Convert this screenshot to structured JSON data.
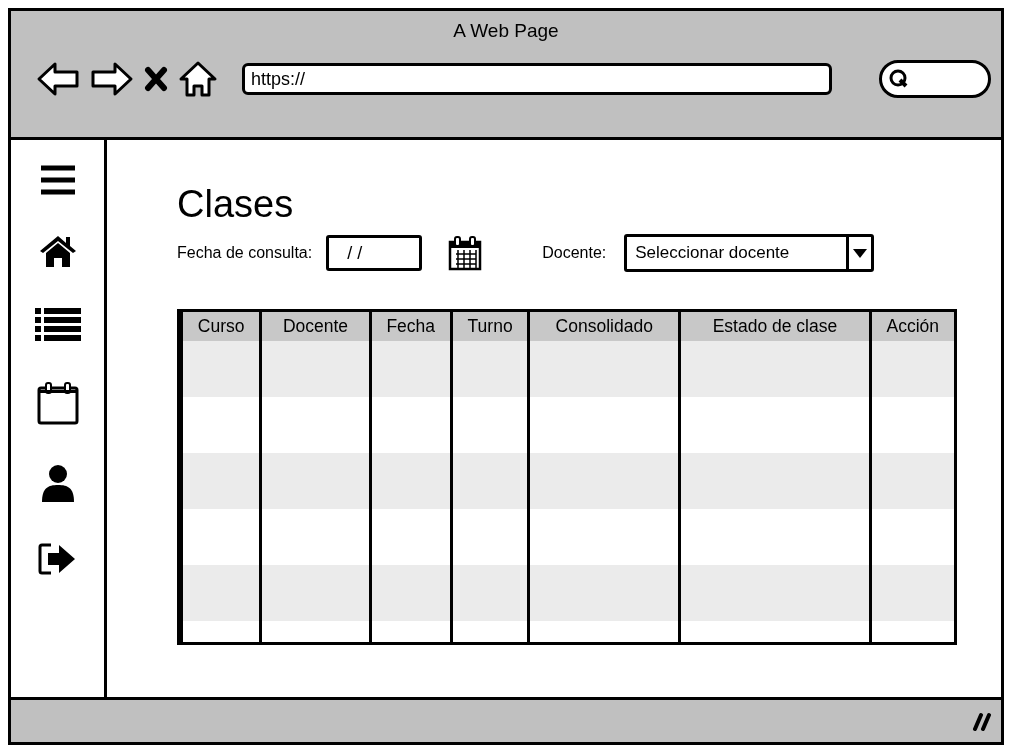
{
  "window": {
    "title": "A Web Page",
    "url": "https://"
  },
  "page": {
    "heading": "Clases"
  },
  "filters": {
    "date_label": "Fecha de consulta:",
    "date_value": "/ /",
    "teacher_label": "Docente:",
    "teacher_value": "Seleccionar docente"
  },
  "table": {
    "columns": [
      "Curso",
      "Docente",
      "Fecha",
      "Turno",
      "Consolidado",
      "Estado de clase",
      "Acción"
    ]
  }
}
